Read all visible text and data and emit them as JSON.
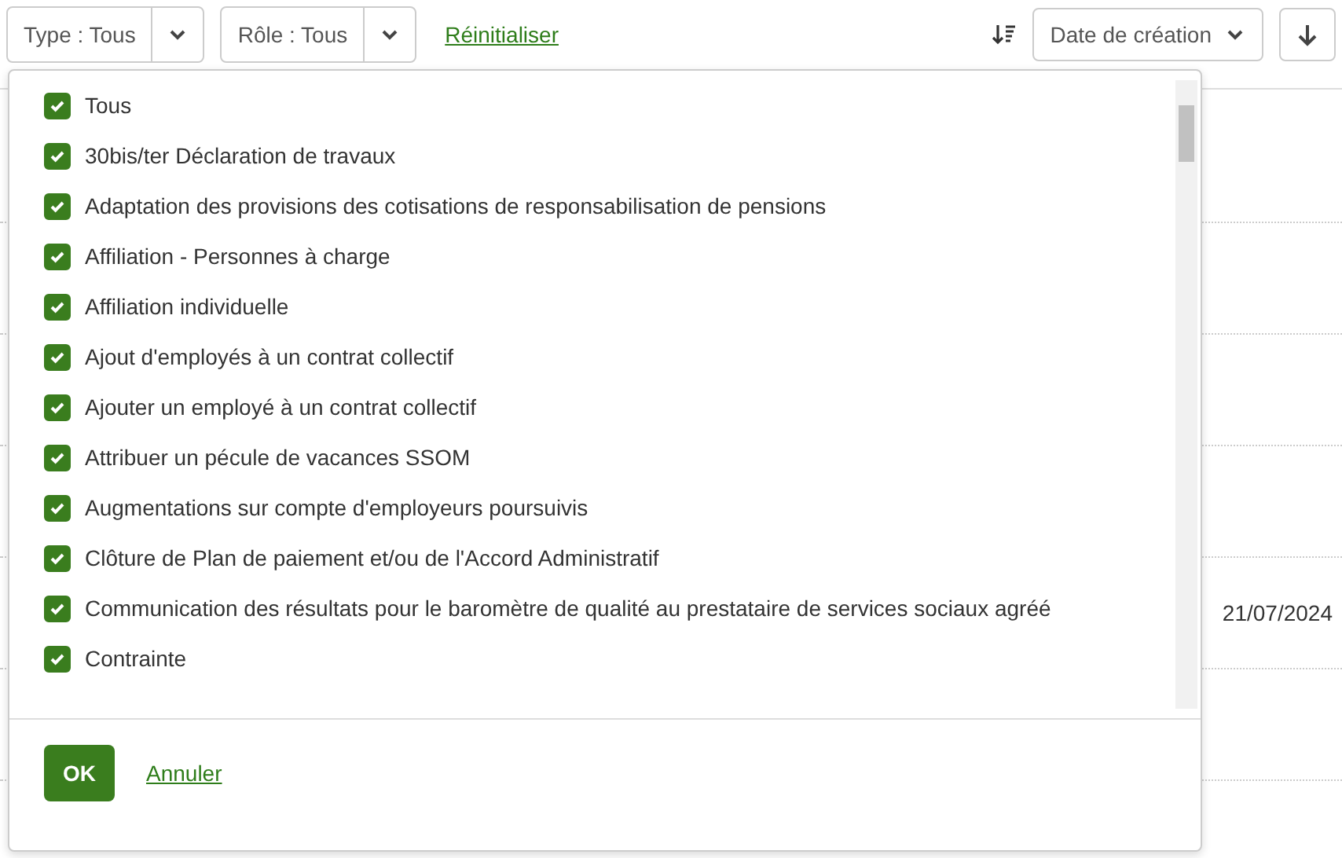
{
  "toolbar": {
    "filters": [
      {
        "label": "Type : Tous"
      },
      {
        "label": "Rôle : Tous"
      }
    ],
    "reset_link": "Réinitialiser",
    "sort": {
      "label": "Date de création"
    }
  },
  "background_rows": [
    {},
    {},
    {},
    {},
    {
      "date": "21/07/2024"
    },
    {},
    {}
  ],
  "dropdown": {
    "options": [
      {
        "label": "Tous",
        "checked": true
      },
      {
        "label": "30bis/ter Déclaration de travaux",
        "checked": true
      },
      {
        "label": "Adaptation des provisions des cotisations de responsabilisation de pensions",
        "checked": true
      },
      {
        "label": "Affiliation - Personnes à charge",
        "checked": true
      },
      {
        "label": "Affiliation individuelle",
        "checked": true
      },
      {
        "label": "Ajout d'employés à un contrat collectif",
        "checked": true
      },
      {
        "label": "Ajouter un employé à un contrat collectif",
        "checked": true
      },
      {
        "label": "Attribuer un pécule de vacances SSOM",
        "checked": true
      },
      {
        "label": "Augmentations sur compte d'employeurs poursuivis",
        "checked": true
      },
      {
        "label": "Clôture de Plan de paiement et/ou de l'Accord Administratif",
        "checked": true
      },
      {
        "label": "Communication des résultats pour le baromètre de qualité au prestataire de services sociaux agréé",
        "checked": true
      },
      {
        "label": "Contrainte",
        "checked": true
      }
    ],
    "ok": "OK",
    "cancel": "Annuler"
  }
}
